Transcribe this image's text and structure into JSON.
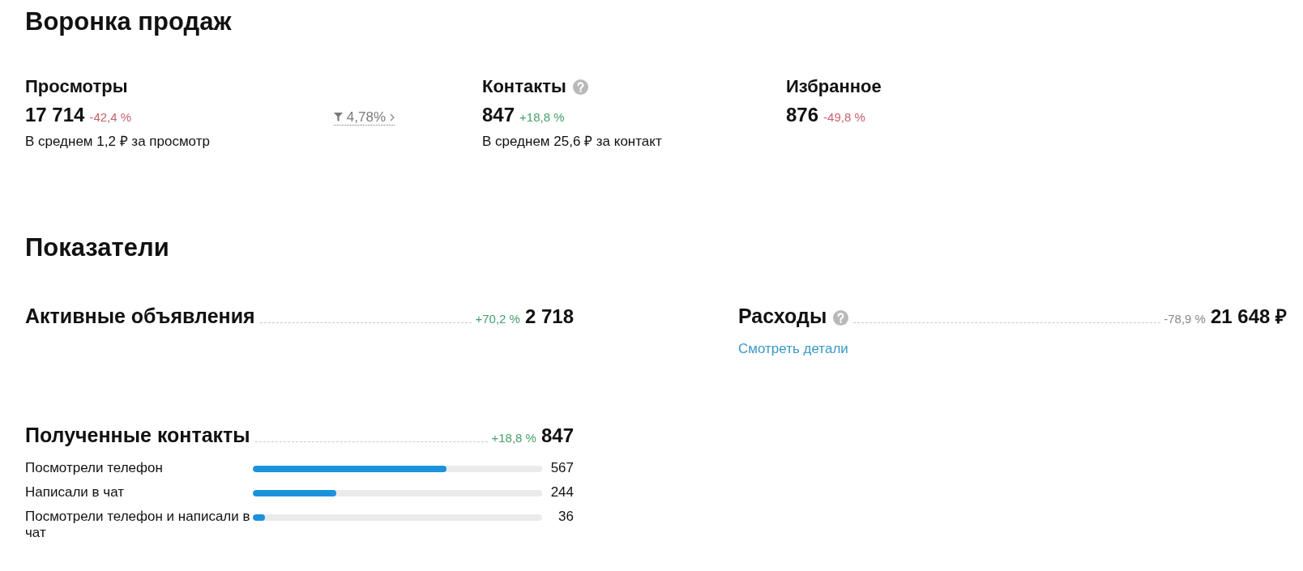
{
  "funnel": {
    "title": "Воронка продаж",
    "metrics": [
      {
        "label": "Просмотры",
        "help": false,
        "value": "17 714",
        "change": {
          "text": "-42,4 %",
          "color": "#c9606e"
        },
        "conversion": "4,78%",
        "note": "В среднем 1,2 ₽ за просмотр"
      },
      {
        "label": "Контакты",
        "help": true,
        "value": "847",
        "change": {
          "text": "+18,8 %",
          "color": "#45a06b"
        },
        "note": "В среднем 25,6 ₽ за контакт"
      },
      {
        "label": "Избранное",
        "help": false,
        "value": "876",
        "change": {
          "text": "-49,8 %",
          "color": "#c9606e"
        }
      }
    ]
  },
  "indicators": {
    "title": "Показатели",
    "items": [
      {
        "label": "Активные объявления",
        "help": false,
        "change": {
          "text": "+70,2 %",
          "color": "#45a06b"
        },
        "value": "2 718"
      },
      {
        "label": "Расходы",
        "help": true,
        "change": {
          "text": "-78,9 %",
          "color": "#888888"
        },
        "value": "21 648 ₽",
        "link": "Смотреть детали"
      },
      {
        "label": "Полученные контакты",
        "help": false,
        "change": {
          "text": "+18,8 %",
          "color": "#45a06b"
        },
        "value": "847",
        "breakdown": [
          {
            "label": "Посмотрели телефон",
            "level": 0.669,
            "count": "567"
          },
          {
            "label": "Написали в чат",
            "level": 0.288,
            "count": "244"
          },
          {
            "label": "Посмотрели телефон и написали в чат",
            "level": 0.043,
            "count": "36"
          }
        ]
      }
    ]
  }
}
